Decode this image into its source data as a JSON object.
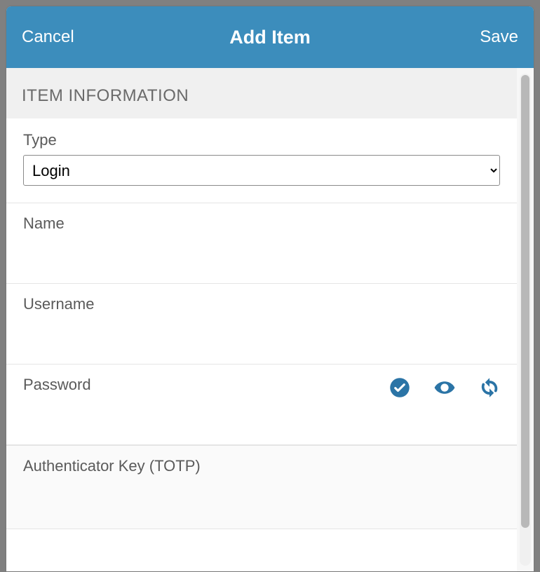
{
  "header": {
    "cancel_label": "Cancel",
    "title": "Add Item",
    "save_label": "Save"
  },
  "section": {
    "title": "ITEM INFORMATION"
  },
  "fields": {
    "type": {
      "label": "Type",
      "value": "Login"
    },
    "name": {
      "label": "Name",
      "value": ""
    },
    "username": {
      "label": "Username",
      "value": ""
    },
    "password": {
      "label": "Password",
      "value": "",
      "icons": {
        "check": "check-circle-icon",
        "eye": "eye-icon",
        "refresh": "refresh-icon"
      }
    },
    "totp": {
      "label": "Authenticator Key (TOTP)",
      "value": ""
    }
  },
  "colors": {
    "accent": "#3c8dbc",
    "icon": "#2b74a6"
  }
}
